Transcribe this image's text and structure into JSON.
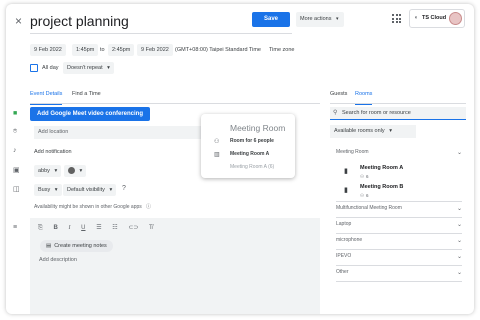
{
  "header": {
    "close_icon": "×",
    "title": "project planning",
    "save_label": "Save",
    "more_actions_label": "More actions",
    "account_name": "TS Cloud"
  },
  "datetime": {
    "start_date": "9 Feb 2022",
    "start_time": "1:45pm",
    "to_label": "to",
    "end_time": "2:45pm",
    "end_date": "9 Feb 2022",
    "timezone_label": "(GMT+08:00) Taipei Standard Time",
    "timezone_button": "Time zone",
    "all_day_label": "All day",
    "repeat_value": "Doesn't repeat"
  },
  "tabs": {
    "event_details": "Event Details",
    "find_time": "Find a Time",
    "guests": "Guests",
    "rooms": "Rooms"
  },
  "details": {
    "meet_button": "Add Google Meet video conferencing",
    "location_placeholder": "Add location",
    "notification_label": "Add notification",
    "calendar_owner": "abby",
    "availability": "Busy",
    "visibility": "Default visibility",
    "availability_note": "Availability might be shown in other Google apps",
    "meeting_notes_button": "Create meeting notes",
    "description_placeholder": "Add description"
  },
  "tooltip": {
    "title": "Meeting Room",
    "capacity": "Room for 6 people",
    "room_name": "Meeting Room A",
    "room_detail": "Meeting Room A (6)"
  },
  "rooms_panel": {
    "search_placeholder": "Search for room or resource",
    "filter_value": "Available rooms only",
    "group_meeting_room": "Meeting Room",
    "rooms": [
      {
        "name": "Meeting Room A",
        "capacity": "6"
      },
      {
        "name": "Meeting Room B",
        "capacity": "6"
      }
    ],
    "categories": [
      "Multifunctional Meeting Room",
      "Laptop",
      "microphone",
      "IPEVO",
      "Other"
    ]
  },
  "colors": {
    "accent": "#1a73e8",
    "field_bg": "#f1f3f4",
    "calendar_color": "#616161"
  }
}
